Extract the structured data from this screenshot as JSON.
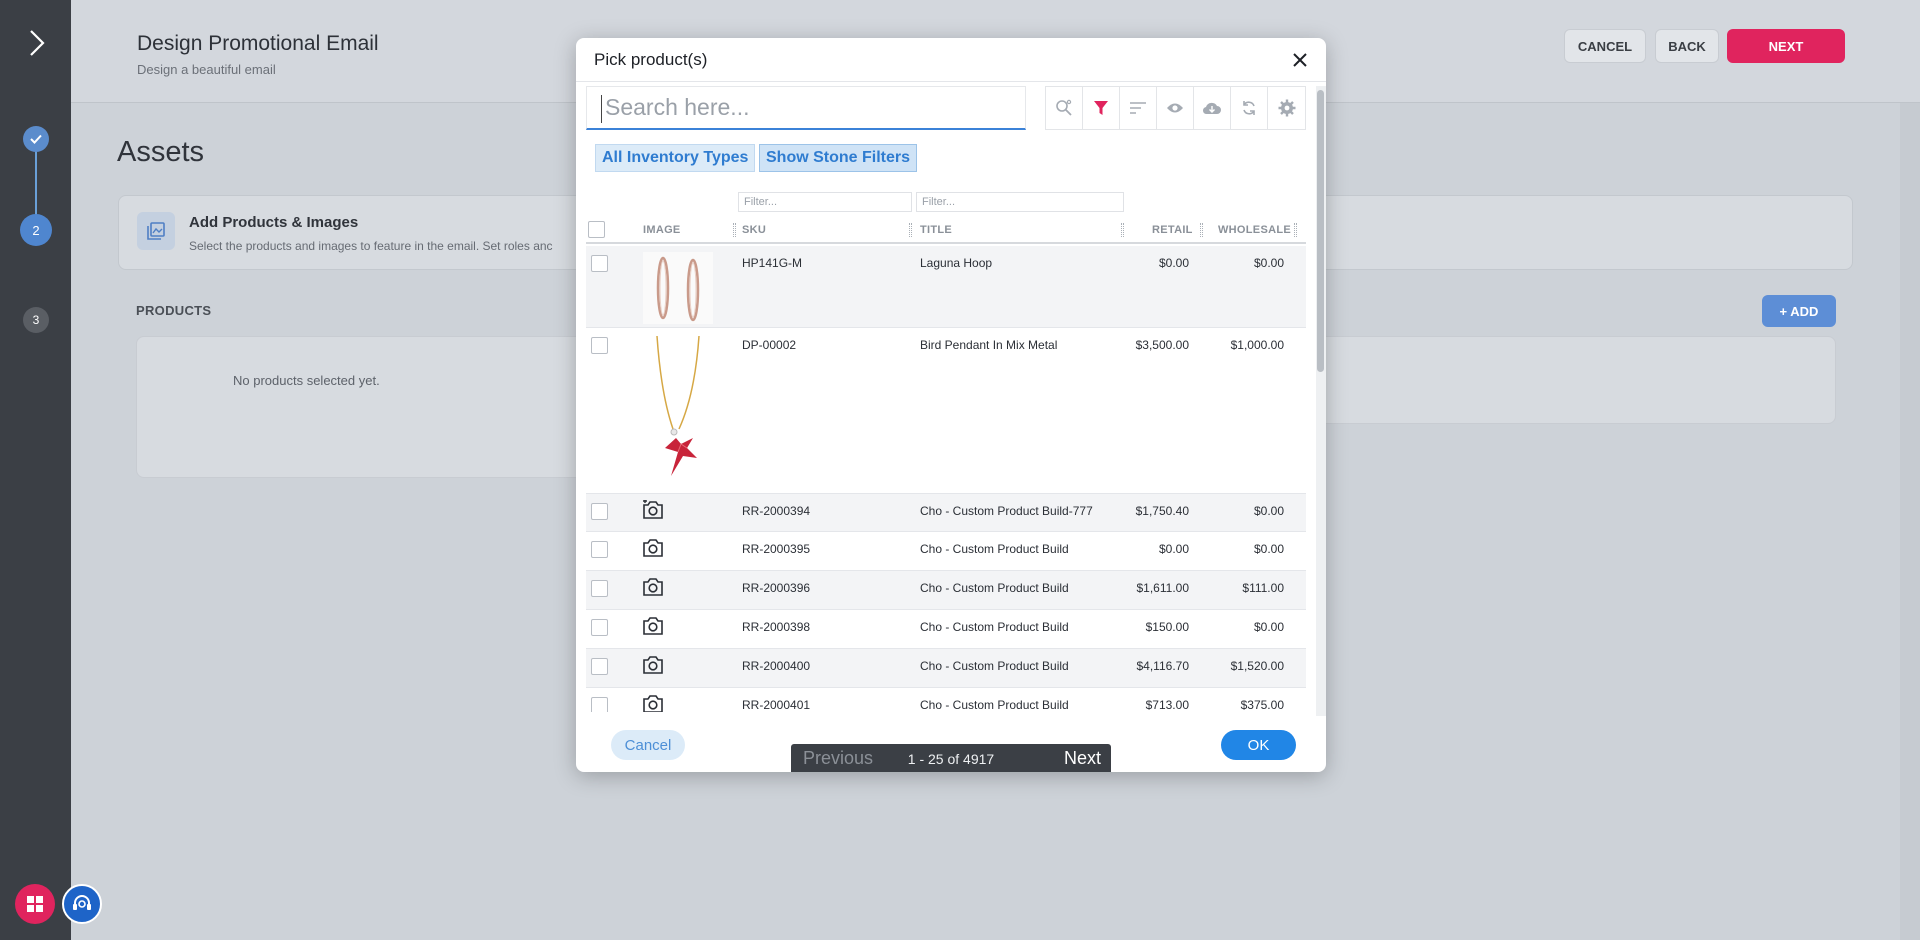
{
  "page": {
    "title": "Design Promotional Email",
    "subtitle": "Design a beautiful email",
    "buttons": {
      "cancel": "CANCEL",
      "back": "BACK",
      "next": "NEXT"
    }
  },
  "steps": [
    {
      "label": "",
      "state": "done",
      "icon": "check-icon"
    },
    {
      "label": "2",
      "state": "active"
    },
    {
      "label": "3",
      "state": "todo"
    }
  ],
  "assets": {
    "heading": "Assets",
    "card_title": "Add Products & Images",
    "card_text": "Select the products and images to feature in the email. Set roles anc",
    "products_label": "PRODUCTS",
    "add_label": "+ ADD",
    "empty_text": "No products selected yet."
  },
  "modal": {
    "title": "Pick product(s)",
    "search_placeholder": "Search here...",
    "toolbar_icons": [
      "search-advanced-icon",
      "filter-icon",
      "sort-icon",
      "eye-icon",
      "cloud-icon",
      "refresh-icon",
      "gear-icon"
    ],
    "chips": [
      "All Inventory Types",
      "Show Stone Filters"
    ],
    "filter_placeholder": "Filter...",
    "columns": [
      "IMAGE",
      "SKU",
      "TITLE",
      "RETAIL",
      "WHOLESALE"
    ],
    "rows": [
      {
        "image": "hoop-earrings",
        "sku": "HP141G-M",
        "title": "Laguna Hoop",
        "retail": "$0.00",
        "wholesale": "$0.00"
      },
      {
        "image": "bird-pendant",
        "sku": "DP-00002",
        "title": "Bird Pendant In Mix Metal",
        "retail": "$3,500.00",
        "wholesale": "$1,000.00"
      },
      {
        "image": "camera-placeholder-icon",
        "sku": "RR-2000394",
        "title": "Cho - Custom Product Build-777",
        "retail": "$1,750.40",
        "wholesale": "$0.00"
      },
      {
        "image": "camera-placeholder-icon",
        "sku": "RR-2000395",
        "title": "Cho - Custom Product Build",
        "retail": "$0.00",
        "wholesale": "$0.00"
      },
      {
        "image": "camera-placeholder-icon",
        "sku": "RR-2000396",
        "title": "Cho - Custom Product Build",
        "retail": "$1,611.00",
        "wholesale": "$111.00"
      },
      {
        "image": "camera-placeholder-icon",
        "sku": "RR-2000398",
        "title": "Cho - Custom Product Build",
        "retail": "$150.00",
        "wholesale": "$0.00"
      },
      {
        "image": "camera-placeholder-icon",
        "sku": "RR-2000400",
        "title": "Cho - Custom Product Build",
        "retail": "$4,116.70",
        "wholesale": "$1,520.00"
      },
      {
        "image": "camera-placeholder-icon",
        "sku": "RR-2000401",
        "title": "Cho - Custom Product Build",
        "retail": "$713.00",
        "wholesale": "$375.00"
      }
    ],
    "footer": {
      "cancel": "Cancel",
      "ok": "OK",
      "previous": "Previous",
      "next": "Next",
      "range": "1 - 25 of 4917"
    }
  },
  "colors": {
    "accent_red": "#e0245e",
    "accent_blue": "#2186e6",
    "rail": "#3b3f45"
  }
}
